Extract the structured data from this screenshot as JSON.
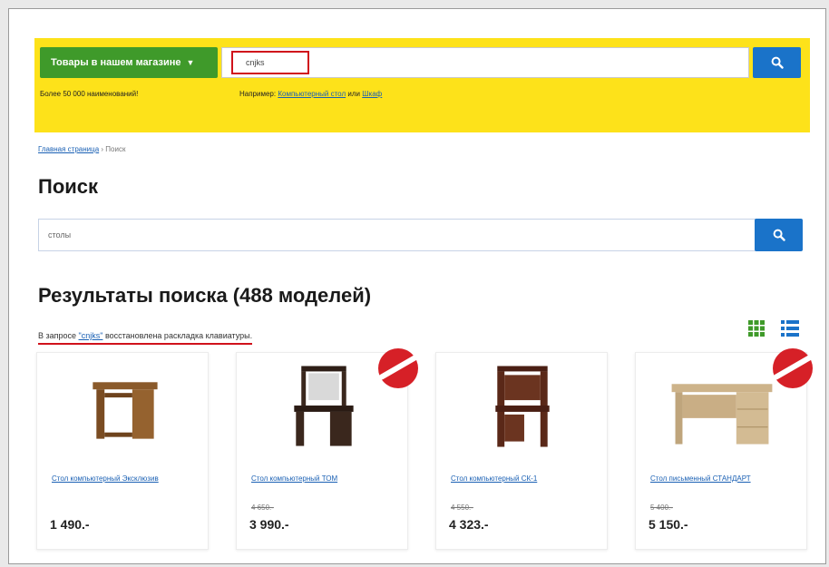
{
  "header": {
    "catalog_button": "Товары в нашем магазине",
    "search_query": "cnjks",
    "subline_left": "Более 50 000 наименований!",
    "example_prefix": "Например:",
    "example_link_1": "Компьютерный стол",
    "example_join": "или",
    "example_link_2": "Шкаф"
  },
  "breadcrumb": {
    "home": "Главная страница",
    "separator": "›",
    "current": "Поиск"
  },
  "page_title": "Поиск",
  "search": {
    "value": "столы"
  },
  "results": {
    "title": "Результаты поиска (488 моделей)",
    "note_prefix": "В запросе ",
    "note_query": "\"cnjks\"",
    "note_suffix": " восстановлена раскладка клавиатуры."
  },
  "products": [
    {
      "name": "Стол компьютерный Эксклюзив",
      "old_price": "",
      "price": "1 490.-",
      "sale": false
    },
    {
      "name": "Стол компьютерный ТОМ",
      "old_price": "4 650.-",
      "price": "3 990.-",
      "sale": true
    },
    {
      "name": "Стол компьютерный СК-1",
      "old_price": "4 550.-",
      "price": "4 323.-",
      "sale": false
    },
    {
      "name": "Стол письменный СТАНДАРТ",
      "old_price": "5 400.-",
      "price": "5 150.-",
      "sale": true
    }
  ],
  "colors": {
    "yellow": "#fde21a",
    "green": "#3f9a2a",
    "blue": "#1a73c9",
    "red": "#d0121b"
  },
  "icons": [
    "chevron-down-icon",
    "search-icon",
    "grid-view-icon",
    "list-view-icon",
    "sale-badge-icon"
  ]
}
